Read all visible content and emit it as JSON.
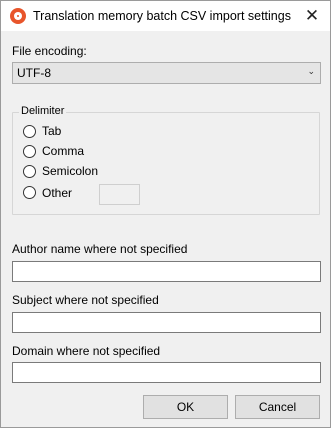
{
  "window": {
    "title": "Translation memory batch CSV import settings",
    "close_glyph": "✕"
  },
  "encoding": {
    "label": "File encoding:",
    "value": "UTF-8"
  },
  "delimiter": {
    "group_label": "Delimiter",
    "options": [
      "Tab",
      "Comma",
      "Semicolon",
      "Other"
    ],
    "other_value": ""
  },
  "fields": {
    "author_label": "Author name where not specified",
    "author_value": "",
    "subject_label": "Subject where not specified",
    "subject_value": "",
    "domain_label": "Domain where not specified",
    "domain_value": ""
  },
  "buttons": {
    "ok": "OK",
    "cancel": "Cancel"
  },
  "icons": {
    "app": "app-logo-icon",
    "dropdown": "chevron-down-icon"
  }
}
